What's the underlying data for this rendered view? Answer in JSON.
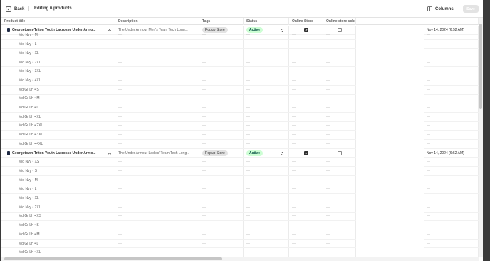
{
  "header": {
    "back_label": "Back",
    "title": "Editing 6 products",
    "columns_label": "Columns",
    "save_label": "Save"
  },
  "columns": [
    "Product title",
    "Description",
    "Tags",
    "Status",
    "Online Store",
    "Online store schedule"
  ],
  "rows": [
    {
      "type": "variant",
      "title": "Mid Nvy • M"
    },
    {
      "type": "variant",
      "title": "Mid Nvy • L"
    },
    {
      "type": "variant",
      "title": "Mid Nvy • XL"
    },
    {
      "type": "variant",
      "title": "Mid Nvy • 2XL"
    },
    {
      "type": "variant",
      "title": "Mid Nvy • 3XL"
    },
    {
      "type": "variant",
      "title": "Mid Nvy • 4XL"
    },
    {
      "type": "variant",
      "title": "Md Gr Lh • S"
    },
    {
      "type": "variant",
      "title": "Md Gr Lh • M"
    },
    {
      "type": "variant",
      "title": "Md Gr Lh • L"
    },
    {
      "type": "variant",
      "title": "Md Gr Lh • XL"
    },
    {
      "type": "variant",
      "title": "Md Gr Lh • 2XL"
    },
    {
      "type": "variant",
      "title": "Md Gr Lh • 3XL"
    },
    {
      "type": "variant",
      "title": "Md Gr Lh • 4XL"
    },
    {
      "type": "product",
      "title": "Georgetown-Triton Youth Lacrosse Under Armo...",
      "description": "The Under Armour Ladies' Team Tech Long...",
      "tag": "Popup Store",
      "status": "Active",
      "online_store": true,
      "schedule": false,
      "date": "Nov 14, 2024 (6:52 AM)"
    },
    {
      "type": "variant",
      "title": "Mid Nvy • XS"
    },
    {
      "type": "variant",
      "title": "Mid Nvy • S"
    },
    {
      "type": "variant",
      "title": "Mid Nvy • M"
    },
    {
      "type": "variant",
      "title": "Mid Nvy • L"
    },
    {
      "type": "variant",
      "title": "Mid Nvy • XL"
    },
    {
      "type": "variant",
      "title": "Mid Nvy • 2XL"
    },
    {
      "type": "variant",
      "title": "Md Gr Lh • XS"
    },
    {
      "type": "variant",
      "title": "Md Gr Lh • S"
    },
    {
      "type": "variant",
      "title": "Md Gr Lh • M"
    },
    {
      "type": "variant",
      "title": "Md Gr Lh • L"
    },
    {
      "type": "variant",
      "title": "Md Gr Lh • XL"
    }
  ],
  "first_product": {
    "title": "Georgetown-Triton Youth Lacrosse Under Armo...",
    "description": "The Under Armour Men's Team Tech Long...",
    "tag": "Popup Store",
    "status": "Active",
    "online_store": true,
    "schedule": false,
    "date": "Nov 14, 2024 (6:52 AM)"
  },
  "empty_cell": "—",
  "colors": {
    "status_bg": "#cdfed4",
    "status_text": "#014b40",
    "tag_bg": "#e3e3e3"
  }
}
